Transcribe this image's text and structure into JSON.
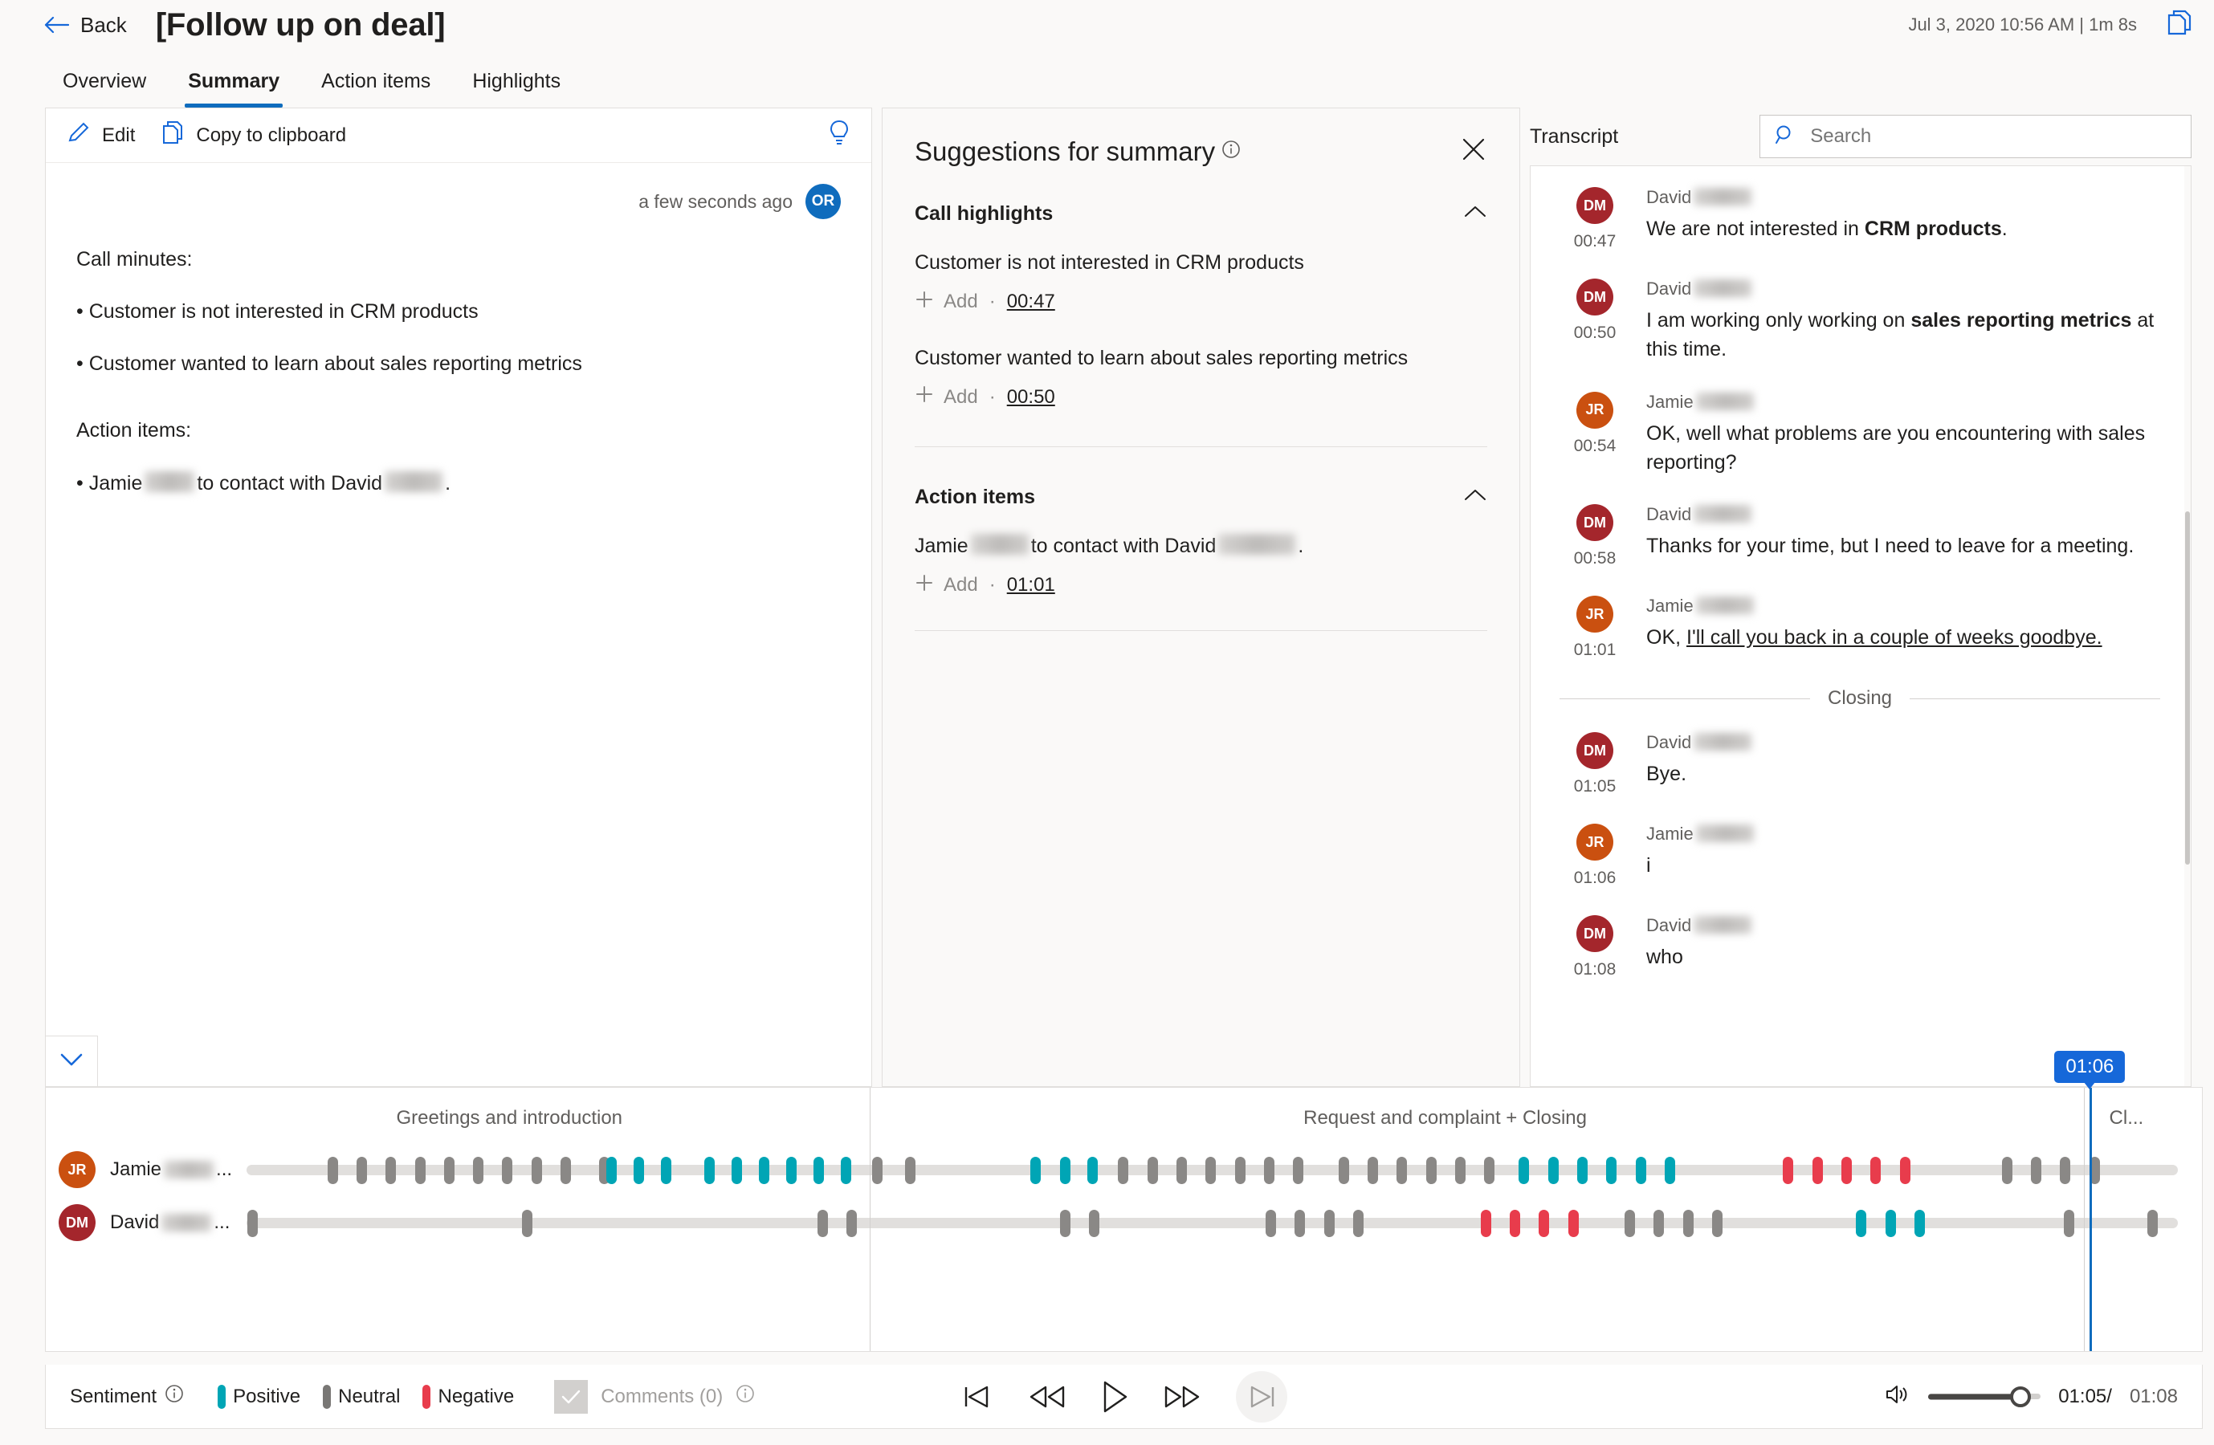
{
  "header": {
    "back_label": "Back",
    "title": "[Follow up on deal]",
    "meta": "Jul 3, 2020 10:56 AM  |  1m 8s",
    "copy_icon": "copy-icon"
  },
  "tabs": [
    {
      "label": "Overview",
      "active": false
    },
    {
      "label": "Summary",
      "active": true
    },
    {
      "label": "Action items",
      "active": false
    },
    {
      "label": "Highlights",
      "active": false
    }
  ],
  "summary": {
    "edit_label": "Edit",
    "copy_label": "Copy to clipboard",
    "bulb_icon": "lightbulb-icon",
    "timestamp": "a few seconds ago",
    "avatar_initials": "OR",
    "call_minutes_heading": "Call minutes:",
    "bullets": [
      "• Customer is not interested in CRM products",
      "• Customer wanted to learn about sales reporting metrics"
    ],
    "action_items_heading": "Action items:",
    "action_item_prefix": "• Jamie",
    "action_item_middle": "to contact with David",
    "action_item_suffix": ".",
    "collapse_icon": "chevron-down-icon"
  },
  "suggestions": {
    "title": "Suggestions for summary",
    "info_icon": "info-icon",
    "close_icon": "close-icon",
    "sections": [
      {
        "title": "Call highlights",
        "chevron": "chevron-up-icon",
        "items": [
          {
            "text": "Customer is not interested in CRM products",
            "add_label": "Add",
            "separator": "·",
            "timestamp": "00:47"
          },
          {
            "text": "Customer wanted to learn about sales reporting metrics",
            "add_label": "Add",
            "separator": "·",
            "timestamp": "00:50"
          }
        ]
      },
      {
        "title": "Action items",
        "chevron": "chevron-up-icon",
        "items": [
          {
            "text_prefix": "Jamie",
            "text_middle": "to contact with David",
            "text_suffix": ".",
            "add_label": "Add",
            "separator": "·",
            "timestamp": "01:01"
          }
        ]
      }
    ]
  },
  "transcript": {
    "label": "Transcript",
    "search_placeholder": "Search",
    "search_icon": "search-icon",
    "entries": [
      {
        "initials": "DM",
        "color_class": "dm",
        "name": "David",
        "time": "00:47",
        "parts": [
          {
            "t": "We are not interested in ",
            "style": "normal"
          },
          {
            "t": "CRM products",
            "style": "bold"
          },
          {
            "t": ".",
            "style": "normal"
          }
        ]
      },
      {
        "initials": "DM",
        "color_class": "dm",
        "name": "David",
        "time": "00:50",
        "parts": [
          {
            "t": "I am working only working on ",
            "style": "normal"
          },
          {
            "t": "sales reporting metrics",
            "style": "bold"
          },
          {
            "t": " at this time.",
            "style": "normal"
          }
        ]
      },
      {
        "initials": "JR",
        "color_class": "jr",
        "name": "Jamie",
        "time": "00:54",
        "parts": [
          {
            "t": "OK, well what problems are you encountering with sales reporting?",
            "style": "normal"
          }
        ]
      },
      {
        "initials": "DM",
        "color_class": "dm",
        "name": "David",
        "time": "00:58",
        "parts": [
          {
            "t": "Thanks for your time, but I need to leave for a meeting.",
            "style": "normal"
          }
        ]
      },
      {
        "initials": "JR",
        "color_class": "jr",
        "name": "Jamie",
        "time": "01:01",
        "parts": [
          {
            "t": "OK, ",
            "style": "normal"
          },
          {
            "t": "I'll call you back in a couple of weeks goodbye.",
            "style": "underline"
          }
        ]
      },
      {
        "divider_label": "Closing"
      },
      {
        "initials": "DM",
        "color_class": "dm",
        "name": "David",
        "time": "01:05",
        "parts": [
          {
            "t": "Bye.",
            "style": "normal"
          }
        ]
      },
      {
        "initials": "JR",
        "color_class": "jr",
        "name": "Jamie",
        "time": "01:06",
        "parts": [
          {
            "t": "i",
            "style": "normal"
          }
        ]
      },
      {
        "initials": "DM",
        "color_class": "dm",
        "name": "David",
        "time": "01:08",
        "parts": [
          {
            "t": "who",
            "style": "normal"
          }
        ]
      }
    ]
  },
  "timeline": {
    "segments": [
      {
        "label": "Greetings and introduction",
        "center_pct": 21.5
      },
      {
        "label": "Request and complaint + Closing",
        "center_pct": 64.9
      }
    ],
    "segment_dividers_pct": [
      38.2
    ],
    "closing_label": "Cl...",
    "playhead_pct": 94.8,
    "playhead_badge": "01:06",
    "tracks": [
      {
        "initials": "JR",
        "color_class": "jr",
        "name": "Jamie",
        "name_suffix": "...",
        "ticks": [
          {
            "pos": 4.7,
            "s": "neutral"
          },
          {
            "pos": 6.3,
            "s": "neutral"
          },
          {
            "pos": 7.9,
            "s": "neutral"
          },
          {
            "pos": 9.5,
            "s": "neutral"
          },
          {
            "pos": 11.1,
            "s": "neutral"
          },
          {
            "pos": 12.7,
            "s": "neutral"
          },
          {
            "pos": 14.3,
            "s": "neutral"
          },
          {
            "pos": 15.9,
            "s": "neutral"
          },
          {
            "pos": 17.5,
            "s": "neutral"
          },
          {
            "pos": 19.6,
            "s": "neutral"
          },
          {
            "pos": 20.0,
            "s": "positive"
          },
          {
            "pos": 21.5,
            "s": "positive"
          },
          {
            "pos": 23.0,
            "s": "positive"
          },
          {
            "pos": 25.4,
            "s": "positive"
          },
          {
            "pos": 26.9,
            "s": "positive"
          },
          {
            "pos": 28.4,
            "s": "positive"
          },
          {
            "pos": 29.9,
            "s": "positive"
          },
          {
            "pos": 31.4,
            "s": "positive"
          },
          {
            "pos": 32.9,
            "s": "positive"
          },
          {
            "pos": 34.6,
            "s": "neutral"
          },
          {
            "pos": 36.4,
            "s": "neutral"
          },
          {
            "pos": 43.3,
            "s": "positive"
          },
          {
            "pos": 44.9,
            "s": "positive"
          },
          {
            "pos": 46.4,
            "s": "positive"
          },
          {
            "pos": 48.1,
            "s": "neutral"
          },
          {
            "pos": 49.7,
            "s": "neutral"
          },
          {
            "pos": 51.3,
            "s": "neutral"
          },
          {
            "pos": 52.9,
            "s": "neutral"
          },
          {
            "pos": 54.5,
            "s": "neutral"
          },
          {
            "pos": 56.1,
            "s": "neutral"
          },
          {
            "pos": 57.7,
            "s": "neutral"
          },
          {
            "pos": 60.2,
            "s": "neutral"
          },
          {
            "pos": 61.8,
            "s": "neutral"
          },
          {
            "pos": 63.4,
            "s": "neutral"
          },
          {
            "pos": 65.0,
            "s": "neutral"
          },
          {
            "pos": 66.6,
            "s": "neutral"
          },
          {
            "pos": 68.2,
            "s": "neutral"
          },
          {
            "pos": 70.1,
            "s": "positive"
          },
          {
            "pos": 71.7,
            "s": "positive"
          },
          {
            "pos": 73.3,
            "s": "positive"
          },
          {
            "pos": 74.9,
            "s": "positive"
          },
          {
            "pos": 76.5,
            "s": "positive"
          },
          {
            "pos": 78.1,
            "s": "positive"
          },
          {
            "pos": 84.6,
            "s": "negative"
          },
          {
            "pos": 86.2,
            "s": "negative"
          },
          {
            "pos": 87.8,
            "s": "negative"
          },
          {
            "pos": 89.4,
            "s": "negative"
          },
          {
            "pos": 91.0,
            "s": "negative"
          },
          {
            "pos": 96.6,
            "s": "neutral"
          },
          {
            "pos": 98.2,
            "s": "neutral"
          },
          {
            "pos": 99.8,
            "s": "neutral"
          },
          {
            "pos": 101.4,
            "s": "neutral"
          }
        ]
      },
      {
        "initials": "DM",
        "color_class": "dm",
        "name": "David",
        "name_suffix": "...",
        "ticks": [
          {
            "pos": 0.3,
            "s": "neutral"
          },
          {
            "pos": 15.4,
            "s": "neutral"
          },
          {
            "pos": 31.6,
            "s": "neutral"
          },
          {
            "pos": 33.2,
            "s": "neutral"
          },
          {
            "pos": 44.9,
            "s": "neutral"
          },
          {
            "pos": 46.5,
            "s": "neutral"
          },
          {
            "pos": 56.2,
            "s": "neutral"
          },
          {
            "pos": 57.8,
            "s": "neutral"
          },
          {
            "pos": 59.4,
            "s": "neutral"
          },
          {
            "pos": 61.0,
            "s": "neutral"
          },
          {
            "pos": 68.0,
            "s": "negative"
          },
          {
            "pos": 69.6,
            "s": "negative"
          },
          {
            "pos": 71.2,
            "s": "negative"
          },
          {
            "pos": 72.8,
            "s": "negative"
          },
          {
            "pos": 75.9,
            "s": "neutral"
          },
          {
            "pos": 77.5,
            "s": "neutral"
          },
          {
            "pos": 79.1,
            "s": "neutral"
          },
          {
            "pos": 80.7,
            "s": "neutral"
          },
          {
            "pos": 88.6,
            "s": "positive"
          },
          {
            "pos": 90.2,
            "s": "positive"
          },
          {
            "pos": 91.8,
            "s": "positive"
          },
          {
            "pos": 100.0,
            "s": "neutral"
          },
          {
            "pos": 104.6,
            "s": "neutral"
          }
        ]
      }
    ]
  },
  "footer": {
    "sentiment_label": "Sentiment",
    "sentiment_info_icon": "info-icon",
    "legend": [
      {
        "label": "Positive",
        "color": "#00a5b5"
      },
      {
        "label": "Neutral",
        "color": "#797775"
      },
      {
        "label": "Negative",
        "color": "#e83c4c"
      }
    ],
    "comments_label": "Comments (0)",
    "comments_info_icon": "info-icon",
    "check_icon": "check-icon",
    "controls": [
      {
        "name": "skip-to-start-button",
        "icon": "skip-back-icon"
      },
      {
        "name": "rewind-button",
        "icon": "rewind-icon"
      },
      {
        "name": "play-button",
        "icon": "play-icon"
      },
      {
        "name": "fast-forward-button",
        "icon": "fast-forward-icon"
      },
      {
        "name": "skip-to-end-button",
        "icon": "skip-forward-icon"
      }
    ],
    "volume_icon": "volume-icon",
    "volume_pct": 82,
    "current_time": "01:05/",
    "total_time": " 01:08"
  }
}
